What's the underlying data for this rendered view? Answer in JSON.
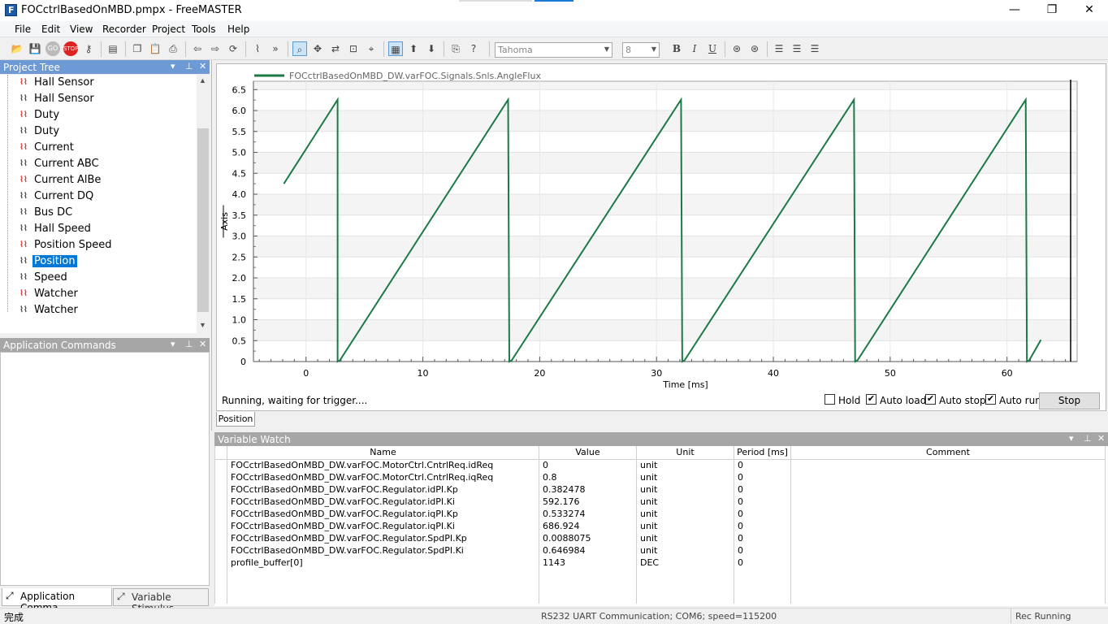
{
  "window": {
    "title": "FOCctrlBasedOnMBD.pmpx - FreeMASTER",
    "minimize": "—",
    "maximize": "❐",
    "close": "✕"
  },
  "menu": [
    "File",
    "Edit",
    "View",
    "Recorder",
    "Project",
    "Tools",
    "Help"
  ],
  "toolbar": {
    "font_name": "Tahoma",
    "font_size": "8",
    "buttons": [
      "open-icon",
      "save-icon",
      "go-icon",
      "stop-icon",
      "key-icon",
      "properties-icon",
      "copy-icon",
      "paste-icon",
      "print-icon",
      "back-icon",
      "forward-icon",
      "refresh-icon",
      "scope-icon",
      "oscilloscope-icon",
      "zoom-fit-icon",
      "zoom-icon",
      "cursor-icon",
      "grid-icon",
      "arrow-up-icon",
      "arrow-down-icon",
      "export-icon",
      "help-icon",
      "bold-icon",
      "italic-icon",
      "underline-icon",
      "align-left-icon",
      "align-center-icon",
      "align-right-icon"
    ]
  },
  "project_tree": {
    "title": "Project Tree",
    "items": [
      {
        "label": "Hall Sensor",
        "kind": "recorder"
      },
      {
        "label": "Hall Sensor",
        "kind": "scope"
      },
      {
        "label": "Duty",
        "kind": "recorder"
      },
      {
        "label": "Duty",
        "kind": "scope"
      },
      {
        "label": "Current",
        "kind": "recorder"
      },
      {
        "label": "Current ABC",
        "kind": "scope"
      },
      {
        "label": "Current AlBe",
        "kind": "recorder"
      },
      {
        "label": "Current DQ",
        "kind": "scope"
      },
      {
        "label": "Bus DC",
        "kind": "scope"
      },
      {
        "label": "Hall Speed",
        "kind": "scope"
      },
      {
        "label": "Position Speed",
        "kind": "recorder"
      },
      {
        "label": "Position",
        "kind": "scope",
        "selected": true
      },
      {
        "label": "Speed",
        "kind": "scope"
      },
      {
        "label": "Watcher",
        "kind": "recorder"
      },
      {
        "label": "Watcher",
        "kind": "scope"
      }
    ]
  },
  "app_commands": {
    "title": "Application Commands"
  },
  "bottom_tabs": [
    "Application Comma...",
    "Variable Stimulus"
  ],
  "chart_data": {
    "type": "line",
    "series": [
      {
        "name": "FOCctrlBasedOnMBD_DW.varFOC.Signals.Snls.AngleFlux",
        "color": "#1b7a46",
        "x": [
          -1.9,
          2.7,
          2.7,
          2.9,
          17.3,
          17.4,
          17.6,
          32.1,
          32.2,
          32.4,
          46.9,
          47.0,
          47.2,
          61.6,
          61.7,
          61.9,
          62.9
        ],
        "y": [
          4.25,
          6.26,
          0,
          0.03,
          6.26,
          0,
          0.03,
          6.26,
          0,
          0.03,
          6.26,
          0,
          0.03,
          6.26,
          0,
          0.03,
          0.52
        ]
      }
    ],
    "xlabel": "Time [ms]",
    "ylabel": "Axis",
    "xlim": [
      -4.5,
      66
    ],
    "ylim": [
      0,
      6.7
    ],
    "xticks": [
      0,
      10,
      20,
      30,
      40,
      50,
      60
    ],
    "yticks": [
      0,
      0.5,
      1.0,
      1.5,
      2.0,
      2.5,
      3.0,
      3.5,
      4.0,
      4.5,
      5.0,
      5.5,
      6.0,
      6.5
    ],
    "ytick_labels": [
      "0",
      "0.5",
      "1.0",
      "1.5",
      "2.0",
      "2.5",
      "3.0",
      "3.5",
      "4.0",
      "4.5",
      "5.0",
      "5.5",
      "6.0",
      "6.5"
    ],
    "grid": true,
    "legend": "top-left"
  },
  "scope": {
    "status": "Running, waiting for trigger....",
    "hold": "Hold",
    "auto_load": "Auto load",
    "auto_stop": "Auto stop",
    "auto_run": "Auto run",
    "stop": "Stop",
    "tab": "Position",
    "checks": {
      "hold": false,
      "auto_load": true,
      "auto_stop": true,
      "auto_run": true
    }
  },
  "variable_watch": {
    "title": "Variable Watch",
    "columns": [
      "Name",
      "Value",
      "Unit",
      "Period [ms]",
      "Comment"
    ],
    "rows": [
      [
        "FOCctrlBasedOnMBD_DW.varFOC.MotorCtrl.CntrlReq.idReq",
        "0",
        "unit",
        "0",
        ""
      ],
      [
        "FOCctrlBasedOnMBD_DW.varFOC.MotorCtrl.CntrlReq.iqReq",
        "0.8",
        "unit",
        "0",
        ""
      ],
      [
        "FOCctrlBasedOnMBD_DW.varFOC.Regulator.idPI.Kp",
        "0.382478",
        "unit",
        "0",
        ""
      ],
      [
        "FOCctrlBasedOnMBD_DW.varFOC.Regulator.idPI.Ki",
        "592.176",
        "unit",
        "0",
        ""
      ],
      [
        "FOCctrlBasedOnMBD_DW.varFOC.Regulator.iqPI.Kp",
        "0.533274",
        "unit",
        "0",
        ""
      ],
      [
        "FOCctrlBasedOnMBD_DW.varFOC.Regulator.iqPI.Ki",
        "686.924",
        "unit",
        "0",
        ""
      ],
      [
        "FOCctrlBasedOnMBD_DW.varFOC.Regulator.SpdPI.Kp",
        "0.0088075",
        "unit",
        "0",
        ""
      ],
      [
        "FOCctrlBasedOnMBD_DW.varFOC.Regulator.SpdPI.Ki",
        "0.646984",
        "unit",
        "0",
        ""
      ],
      [
        "profile_buffer[0]",
        "1143",
        "DEC",
        "0",
        ""
      ]
    ]
  },
  "statusbar": {
    "left": "完成",
    "comm": "RS232 UART Communication; COM6; speed=115200",
    "right": "Rec Running"
  }
}
